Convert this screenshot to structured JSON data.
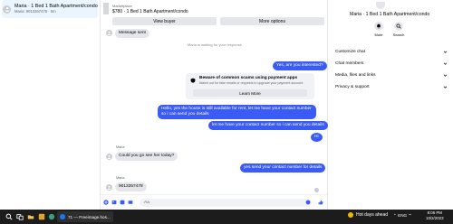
{
  "conversation_list": {
    "active_item": {
      "title": "Maria · 1 Bed 1 Bath Apartment/condo",
      "subtitle": "Maria: 9013357478 · 5m"
    }
  },
  "chat": {
    "listing": {
      "label": "Marketplace",
      "title": "$780 · 1 Bed 1 Bath Apartment/condo",
      "view_buyer": "View buyer",
      "more_options": "More options"
    },
    "messages": {
      "sent_note": "Message sent",
      "waiting_note": "Maria is waiting for your response.",
      "out_1": "Yes, are you interested?",
      "scam_title": "Beware of common scams using payment apps",
      "scam_sub": "Watch out for fake emails or requests to upgrade your payment account.",
      "learn_more": "Learn More",
      "out_2": "Hello, yes the house is still available for rent, let me have your contact number so i can send you details",
      "out_3": "let me have your contact number so i can send you details",
      "out_4": "Hi",
      "sender_1": "Maria",
      "in_1": "Could you go see her today?",
      "out_5": "yes send your contact number for details",
      "sender_2": "Maria",
      "in_2": "9013357478"
    },
    "composer": {
      "placeholder": "Aa"
    }
  },
  "details": {
    "title": "Maria · 1 Bed 1 Bath Apartment/condo",
    "mute": "Mute",
    "search": "Search",
    "sections": [
      "Customize chat",
      "Chat members",
      "Media, files and links",
      "Privacy & support"
    ]
  },
  "taskbar": {
    "app_label": "71 — Freeimage.hos...",
    "weather": "Hot days ahead",
    "language": "ENG",
    "time": "8:06 PM",
    "date": "10/2/2023"
  },
  "colors": {
    "accent": "#3b5bf6",
    "bubble_in": "#e4e6eb",
    "taskbar": "#1c1c1c"
  }
}
